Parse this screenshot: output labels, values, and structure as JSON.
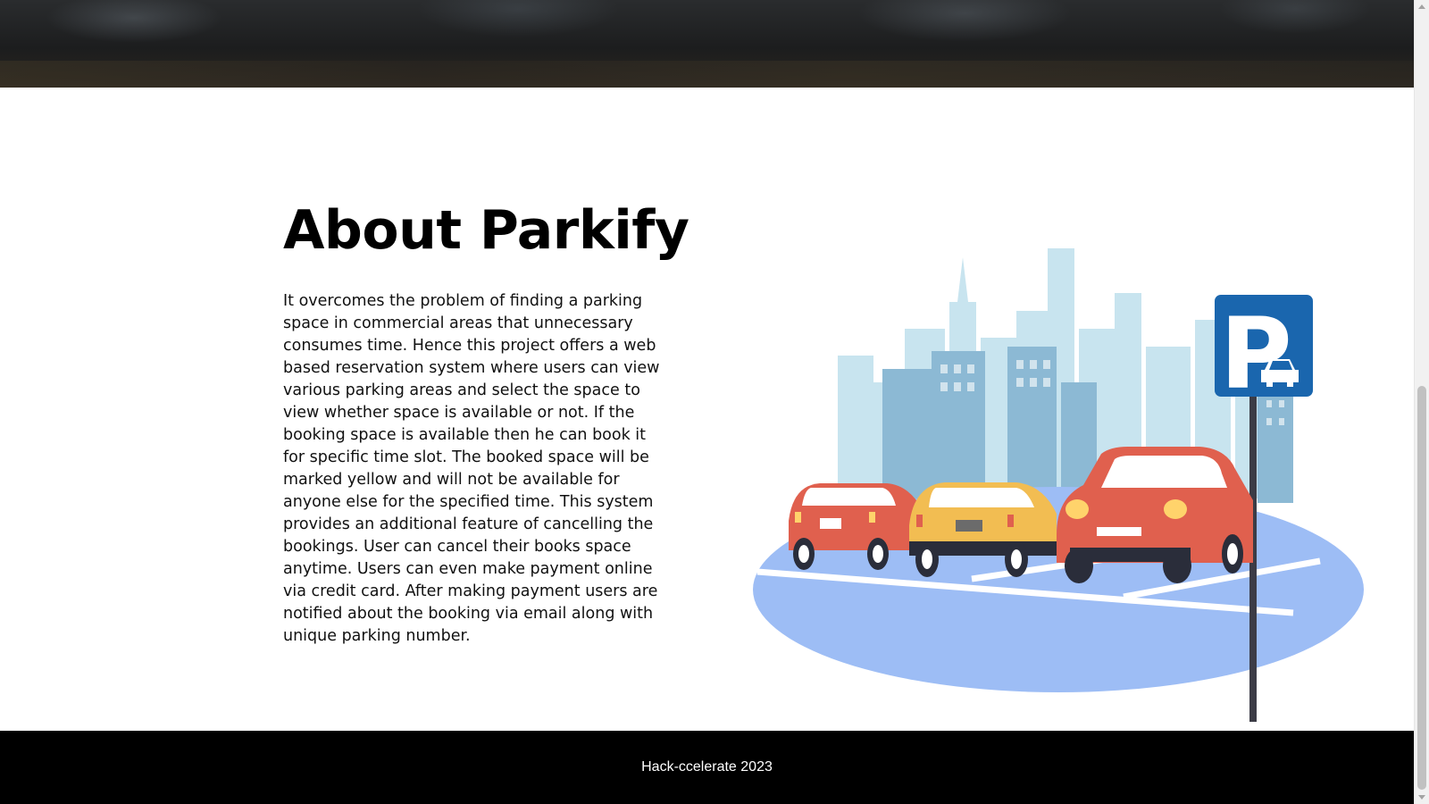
{
  "about": {
    "title": "About Parkify",
    "description": "It overcomes the problem of finding a parking space in commercial areas that unnecessary consumes time. Hence this project offers a web based reservation system where users can view various parking areas and select the space to view whether space is available or not. If the booking space is available then he can book it for specific time slot. The booked space will be marked yellow and will not be available for anyone else for the specified time. This system provides an additional feature of cancelling the bookings. User can cancel their books space anytime. Users can even make payment online via credit card. After making payment users are notified about the booking via email along with unique parking number.",
    "illustration": {
      "sign_letter": "P",
      "colors": {
        "sign": "#1a66ae",
        "ground": "#9dbdf5",
        "car_red": "#e0604e",
        "car_yellow": "#f2bd52",
        "city": "#b9dcea"
      }
    }
  },
  "footer": {
    "text": "Hack-ccelerate 2023"
  }
}
